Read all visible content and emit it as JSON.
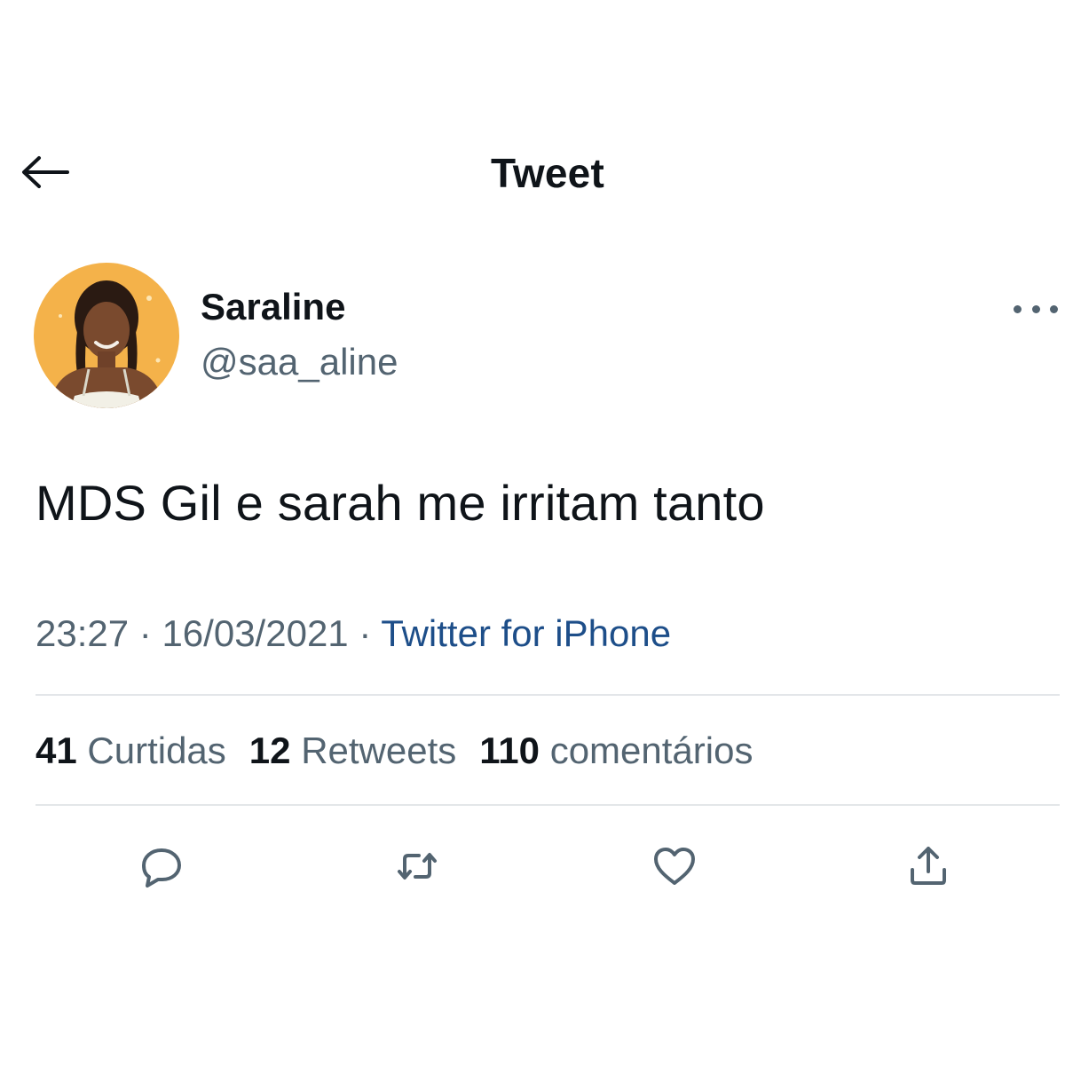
{
  "header": {
    "title": "Tweet",
    "back_icon": "arrow-left-icon"
  },
  "author": {
    "display_name": "Saraline",
    "handle": "@saa_aline",
    "avatar_icon": "avatar-photo",
    "more_icon": "more-horizontal-icon"
  },
  "tweet": {
    "text": "MDS Gil e sarah me irritam tanto",
    "time": "23:27",
    "separator": "·",
    "date": "16/03/2021",
    "source": "Twitter for iPhone"
  },
  "stats": {
    "likes_count": "41",
    "likes_label": "Curtidas",
    "retweets_count": "12",
    "retweets_label": "Retweets",
    "comments_count": "110",
    "comments_label": "comentários"
  },
  "actions": [
    {
      "icon": "reply-icon"
    },
    {
      "icon": "retweet-icon"
    },
    {
      "icon": "like-icon"
    },
    {
      "icon": "share-icon"
    }
  ],
  "colors": {
    "text_primary": "#0f1419",
    "text_secondary": "#536471",
    "source_link": "#1d4e89",
    "avatar_background": "#f4b24a",
    "divider": "#e3e6e9"
  }
}
